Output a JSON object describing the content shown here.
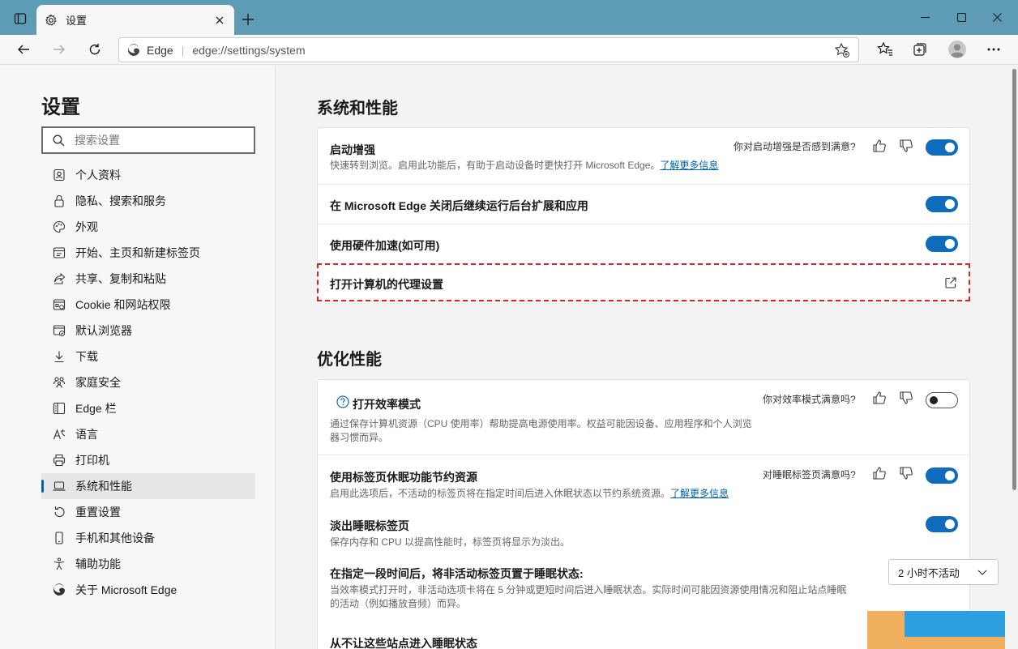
{
  "browser": {
    "tab_title": "设置",
    "address_site_label": "Edge",
    "address_url": "edge://settings/system"
  },
  "sidebar": {
    "title": "设置",
    "search_placeholder": "搜索设置",
    "items": [
      {
        "label": "个人资料",
        "icon": "profile-icon"
      },
      {
        "label": "隐私、搜索和服务",
        "icon": "lock-icon"
      },
      {
        "label": "外观",
        "icon": "palette-icon"
      },
      {
        "label": "开始、主页和新建标签页",
        "icon": "home-tab-icon"
      },
      {
        "label": "共享、复制和粘贴",
        "icon": "share-icon"
      },
      {
        "label": "Cookie 和网站权限",
        "icon": "site-permissions-icon"
      },
      {
        "label": "默认浏览器",
        "icon": "default-browser-icon"
      },
      {
        "label": "下载",
        "icon": "download-icon"
      },
      {
        "label": "家庭安全",
        "icon": "family-icon"
      },
      {
        "label": "Edge 栏",
        "icon": "edge-bar-icon"
      },
      {
        "label": "语言",
        "icon": "language-icon"
      },
      {
        "label": "打印机",
        "icon": "printer-icon"
      },
      {
        "label": "系统和性能",
        "icon": "laptop-icon",
        "active": true
      },
      {
        "label": "重置设置",
        "icon": "reset-icon"
      },
      {
        "label": "手机和其他设备",
        "icon": "phone-icon"
      },
      {
        "label": "辅助功能",
        "icon": "accessibility-icon"
      },
      {
        "label": "关于 Microsoft Edge",
        "icon": "edge-logo-icon"
      }
    ]
  },
  "system_section": {
    "title": "系统和性能",
    "startup_boost": {
      "title": "启动增强",
      "desc": "快速转到浏览。启用此功能后，有助于启动设备时更快打开 Microsoft Edge。",
      "link": "了解更多信息",
      "feedback": "你对启动增强是否感到满意?",
      "enabled": true
    },
    "background_run": {
      "title": "在 Microsoft Edge 关闭后继续运行后台扩展和应用",
      "enabled": true
    },
    "hardware_accel": {
      "title": "使用硬件加速(如可用)",
      "enabled": true
    },
    "proxy": {
      "title": "打开计算机的代理设置"
    }
  },
  "perf_section": {
    "title": "优化性能",
    "efficiency": {
      "title": "打开效率模式",
      "desc": "通过保存计算机资源（CPU 使用率）帮助提高电源使用率。权益可能因设备、应用程序和个人浏览器习惯而异。",
      "feedback": "你对效率模式满意吗?",
      "enabled": false
    },
    "sleeping_tabs": {
      "title": "使用标签页休眠功能节约资源",
      "desc": "启用此选项后，不活动的标签页将在指定时间后进入休眠状态以节约系统资源。",
      "link": "了解更多信息",
      "feedback": "对睡眠标签页满意吗?",
      "enabled": true
    },
    "fade_tabs": {
      "title": "淡出睡眠标签页",
      "desc": "保存内存和 CPU 以提高性能时，标签页将显示为淡出。",
      "enabled": true
    },
    "sleep_after": {
      "title": "在指定一段时间后，将非活动标签页置于睡眠状态:",
      "desc": "当效率模式打开时，非活动选项卡将在 5 分钟或更短时间后进入睡眠状态。实际时间可能因资源使用情况和阻止站点睡眠的活动（例如播放音频）而异。",
      "selected": "2 小时不活动"
    },
    "never_sleep": {
      "title": "从不让这些站点进入睡眠状态"
    }
  },
  "colors": {
    "titlebar": "#5d9cb4",
    "accent": "#0f6cbd",
    "highlight_border": "#e02020"
  }
}
